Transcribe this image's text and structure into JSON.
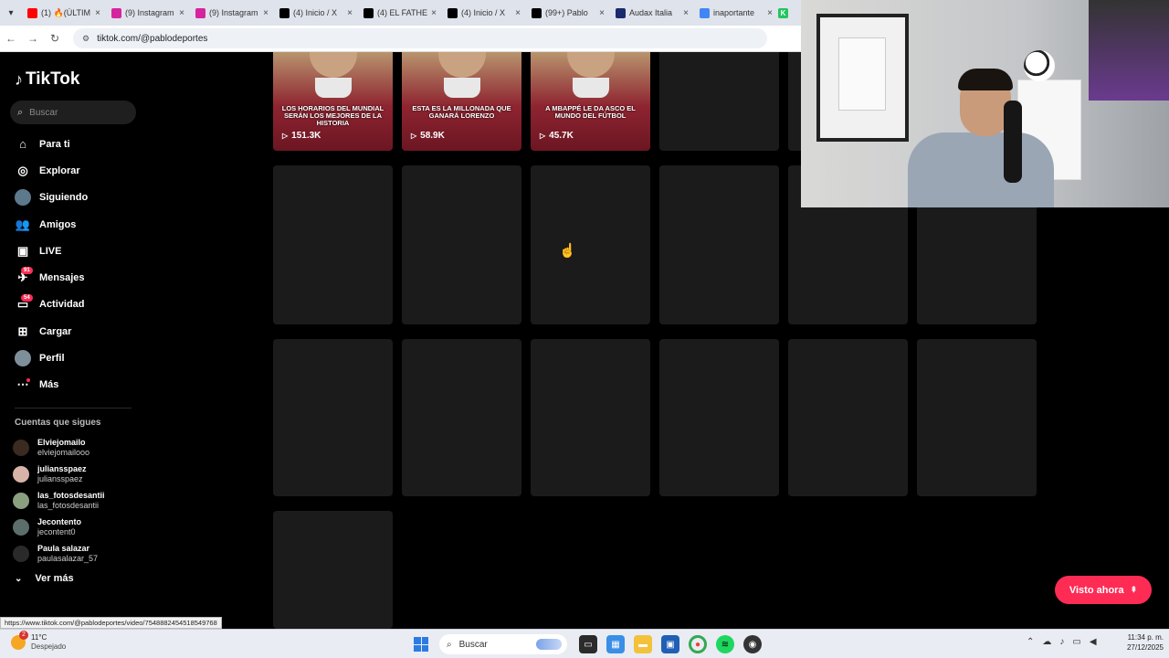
{
  "browser": {
    "tabs": [
      {
        "title": "(1) 🔥(ÚLTIM",
        "favicon": "youtube-icon",
        "color": "#ff0000"
      },
      {
        "title": "(9) Instagram",
        "favicon": "instagram-icon",
        "color": "#d6249f"
      },
      {
        "title": "(9) Instagram",
        "favicon": "instagram-icon",
        "color": "#d6249f"
      },
      {
        "title": "(4) Inicio / X",
        "favicon": "x-icon",
        "color": "#000000"
      },
      {
        "title": "(4) EL FATHE",
        "favicon": "x-icon",
        "color": "#000000"
      },
      {
        "title": "(4) Inicio / X",
        "favicon": "x-icon",
        "color": "#000000"
      },
      {
        "title": "(99+) Pablo",
        "favicon": "tiktok-icon",
        "color": "#000000"
      },
      {
        "title": "Audax Italia",
        "favicon": "site-icon",
        "color": "#1a2a6c"
      },
      {
        "title": "inaportante",
        "favicon": "google-icon",
        "color": "#4285f4"
      }
    ],
    "url": "tiktok.com/@pablodeportes"
  },
  "sidebar": {
    "logo": "TikTok",
    "search_placeholder": "Buscar",
    "nav": [
      {
        "label": "Para ti",
        "icon": "home-icon",
        "glyph": "⌂"
      },
      {
        "label": "Explorar",
        "icon": "compass-icon",
        "glyph": "◎"
      },
      {
        "label": "Siguiendo",
        "icon": "following-avatar-icon",
        "glyph": "●"
      },
      {
        "label": "Amigos",
        "icon": "friends-icon",
        "glyph": "👥"
      },
      {
        "label": "LIVE",
        "icon": "live-icon",
        "glyph": "▣"
      },
      {
        "label": "Mensajes",
        "icon": "messages-icon",
        "glyph": "✈",
        "badge": "91"
      },
      {
        "label": "Actividad",
        "icon": "activity-icon",
        "glyph": "▭",
        "badge": "54"
      },
      {
        "label": "Cargar",
        "icon": "upload-icon",
        "glyph": "⊞"
      },
      {
        "label": "Perfil",
        "icon": "profile-avatar-icon",
        "glyph": "●"
      },
      {
        "label": "Más",
        "icon": "more-icon",
        "glyph": "⋯",
        "dot": true
      }
    ],
    "following_title": "Cuentas que sigues",
    "accounts": [
      {
        "name": "Elviejomailo",
        "handle": "elviejomailooo",
        "color": "#3a2a20"
      },
      {
        "name": "juliansspaez",
        "handle": "juliansspaez",
        "color": "#d8b4a8"
      },
      {
        "name": "las_fotosdesantii",
        "handle": "las_fotosdesantii",
        "color": "#8aa080"
      },
      {
        "name": "Jecontento",
        "handle": "jecontent0",
        "color": "#5b6e6a"
      },
      {
        "name": "Paula salazar",
        "handle": "paulasalazar_57",
        "color": "#2a2a2a"
      }
    ],
    "see_more": "Ver más"
  },
  "videos": [
    {
      "caption": "LOS HORARIOS DEL MUNDIAL SERÁN LOS MEJORES DE LA HISTORIA",
      "views": "151.3K"
    },
    {
      "caption": "ESTA ES LA MILLONADA QUE GANARÁ LORENZO",
      "views": "58.9K"
    },
    {
      "caption": "A MBAPPÉ LE DA ASCO EL MUNDO DEL FÚTBOL",
      "views": "45.7K"
    }
  ],
  "visto_ahora": "Visto ahora",
  "status_url": "https://www.tiktok.com/@pablodeportes/video/7548882454518549768",
  "taskbar": {
    "weather_temp": "11°C",
    "weather_desc": "Despejado",
    "weather_badge": "2",
    "search": "Buscar",
    "time": "11:34 p. m.",
    "date": "27/12/2025"
  }
}
